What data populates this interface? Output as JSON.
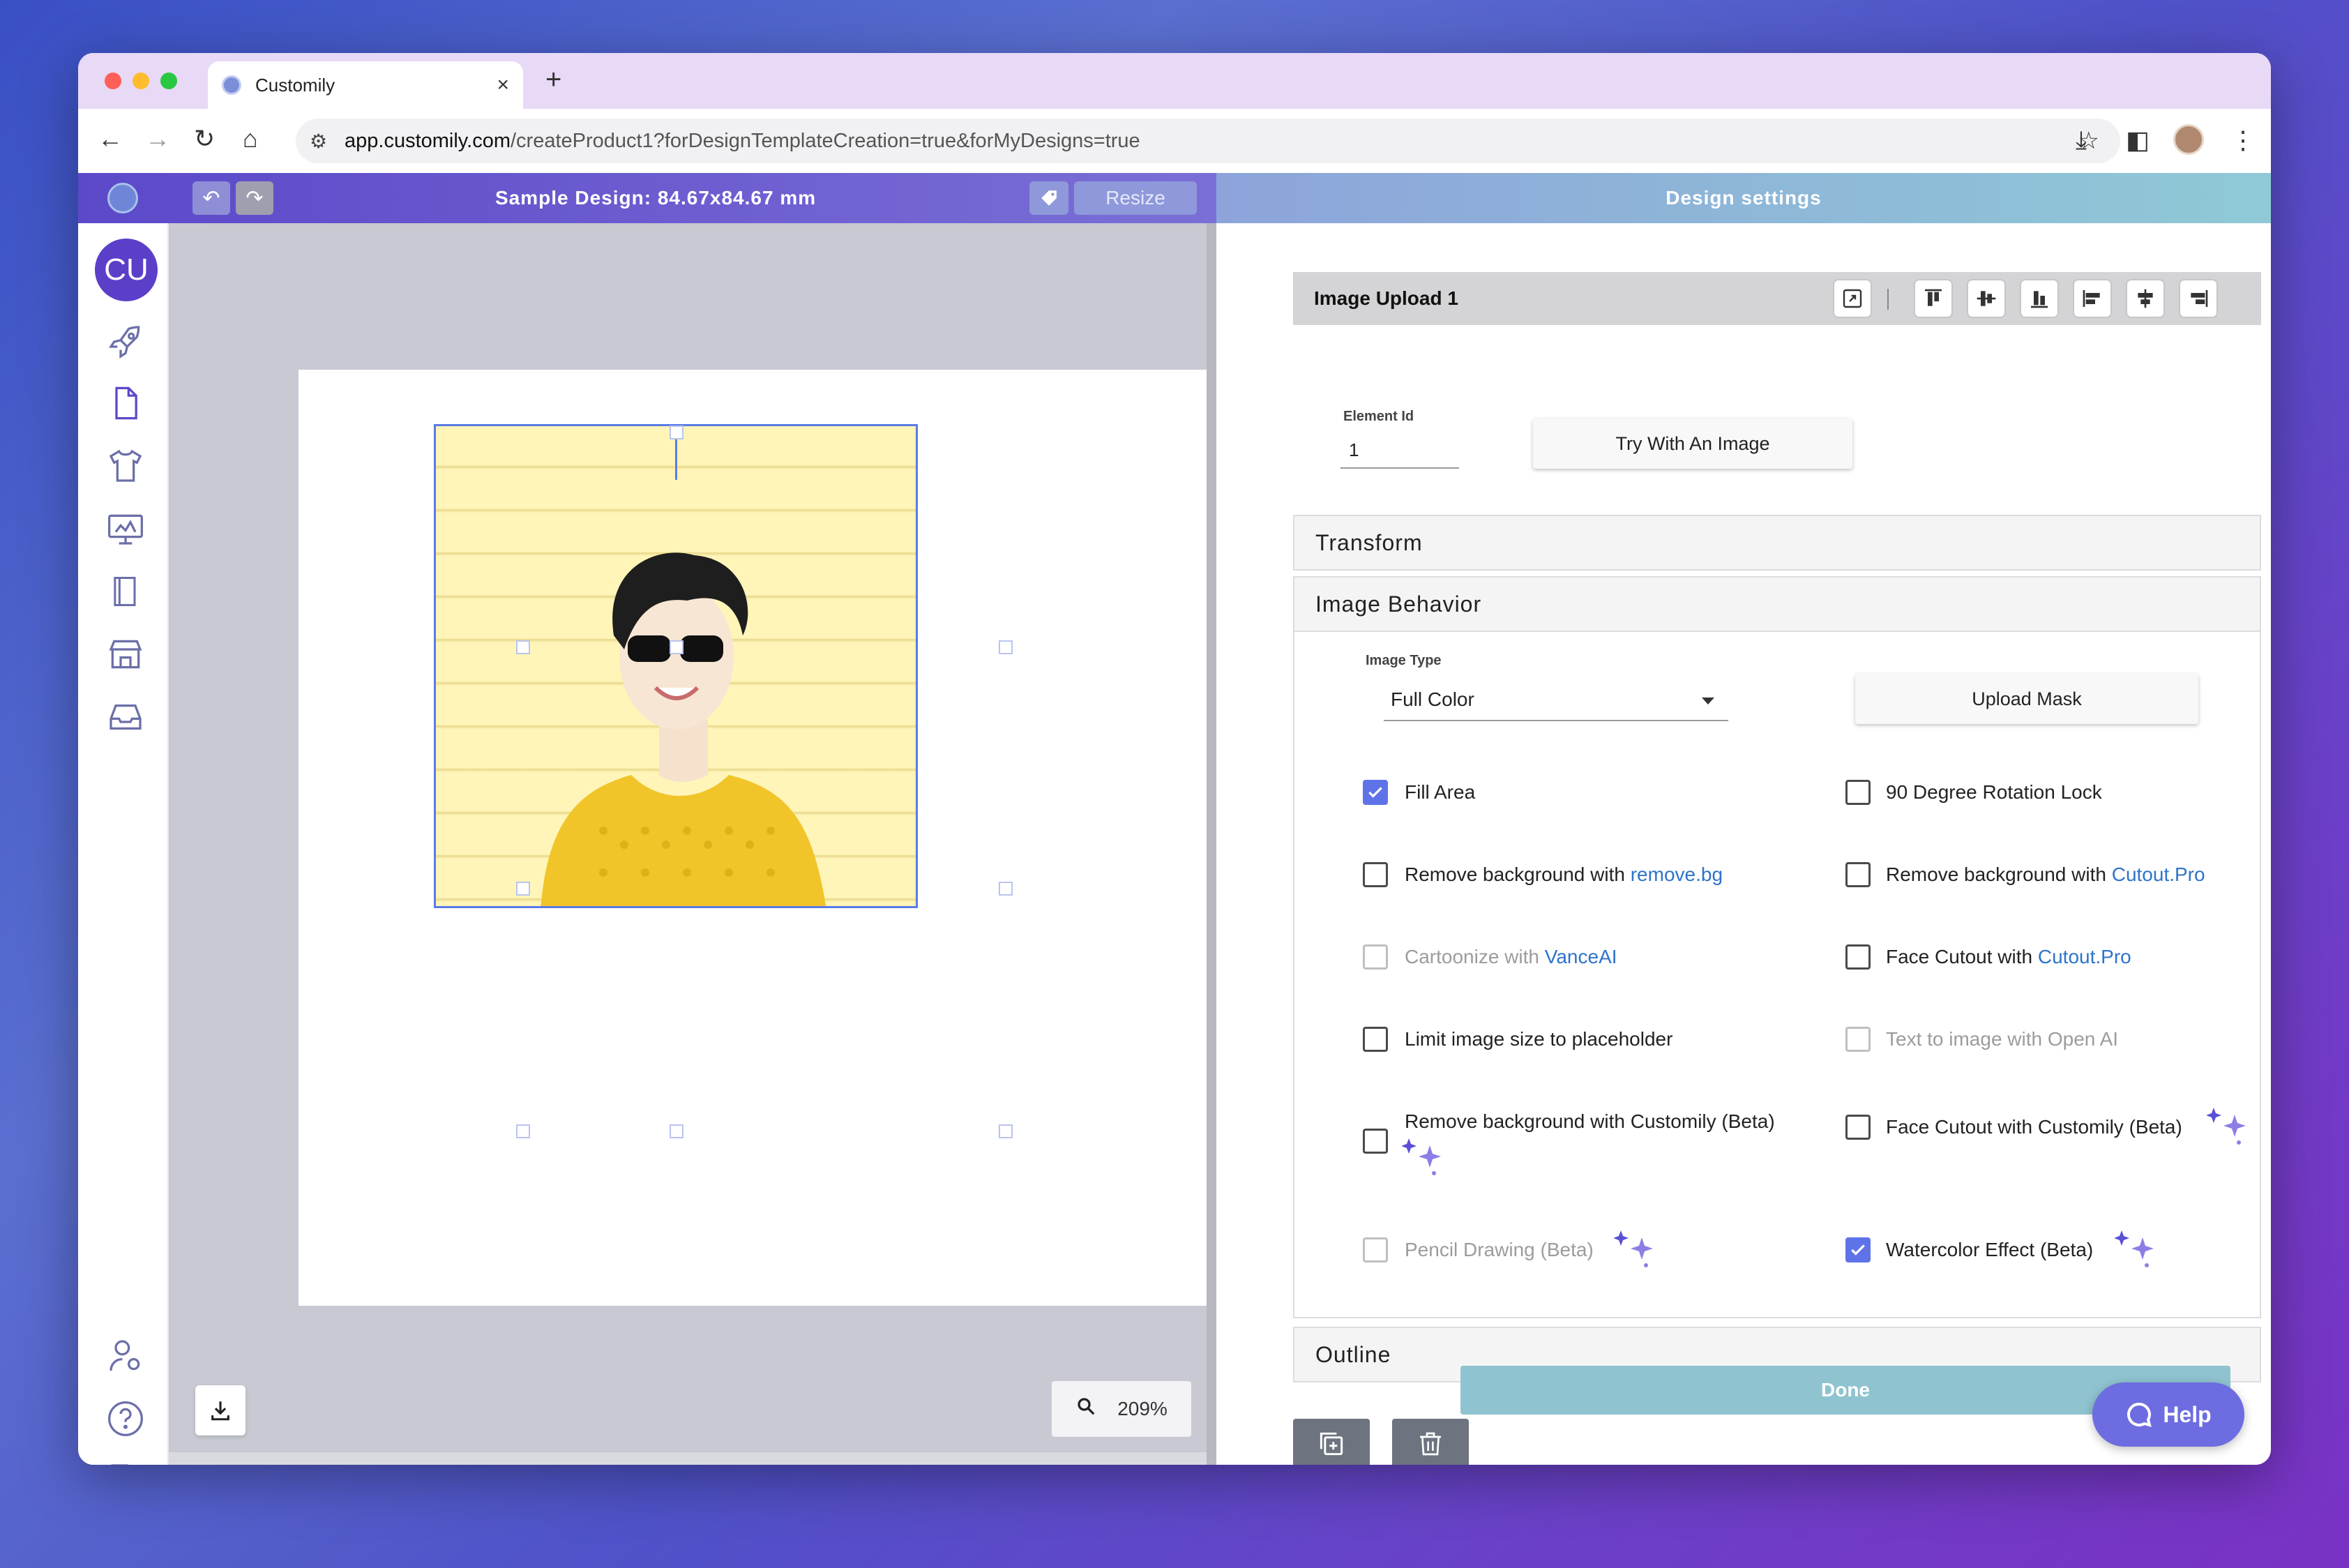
{
  "browser": {
    "tab_title": "Customily",
    "url_host": "app.customily.com",
    "url_path": "/createProduct1?forDesignTemplateCreation=true&forMyDesigns=true"
  },
  "header": {
    "design_title": "Sample Design: 84.67x84.67 mm",
    "resize_label": "Resize",
    "settings_title": "Design settings"
  },
  "sidebar": {
    "avatar_initials": "CU"
  },
  "canvas": {
    "zoom_level": "209%"
  },
  "element": {
    "name": "Image Upload 1",
    "id_label": "Element Id",
    "id_value": "1",
    "try_button": "Try With An Image"
  },
  "sections": {
    "transform": "Transform",
    "image_behavior": "Image Behavior",
    "outline": "Outline"
  },
  "image_behavior": {
    "type_label": "Image Type",
    "type_value": "Full Color",
    "upload_mask": "Upload Mask",
    "options": {
      "fill_area": "Fill Area",
      "rotation_lock": "90 Degree Rotation Lock",
      "remove_bg_prefix": "Remove background with ",
      "remove_bg_link": "remove.bg",
      "remove_bg_cutout_prefix": "Remove background with ",
      "remove_bg_cutout_link": "Cutout.Pro",
      "cartoonize_prefix": "Cartoonize with ",
      "cartoonize_link": "VanceAI",
      "face_cutout_prefix": "Face Cutout with ",
      "face_cutout_link": "Cutout.Pro",
      "limit_size": "Limit image size to placeholder",
      "text_to_image": "Text to image with Open AI",
      "remove_bg_customily": "Remove background with Customily (Beta)",
      "face_cutout_customily": "Face Cutout with Customily (Beta)",
      "pencil_drawing": "Pencil Drawing (Beta)",
      "watercolor": "Watercolor Effect (Beta)"
    }
  },
  "footer": {
    "done_label": "Done",
    "help_label": "Help"
  },
  "colors": {
    "accent": "#5b3fc9",
    "checkbox_checked": "#5f73e8",
    "link": "#2e74c9",
    "done": "#8fc3d0",
    "help": "#6d6ce0"
  }
}
